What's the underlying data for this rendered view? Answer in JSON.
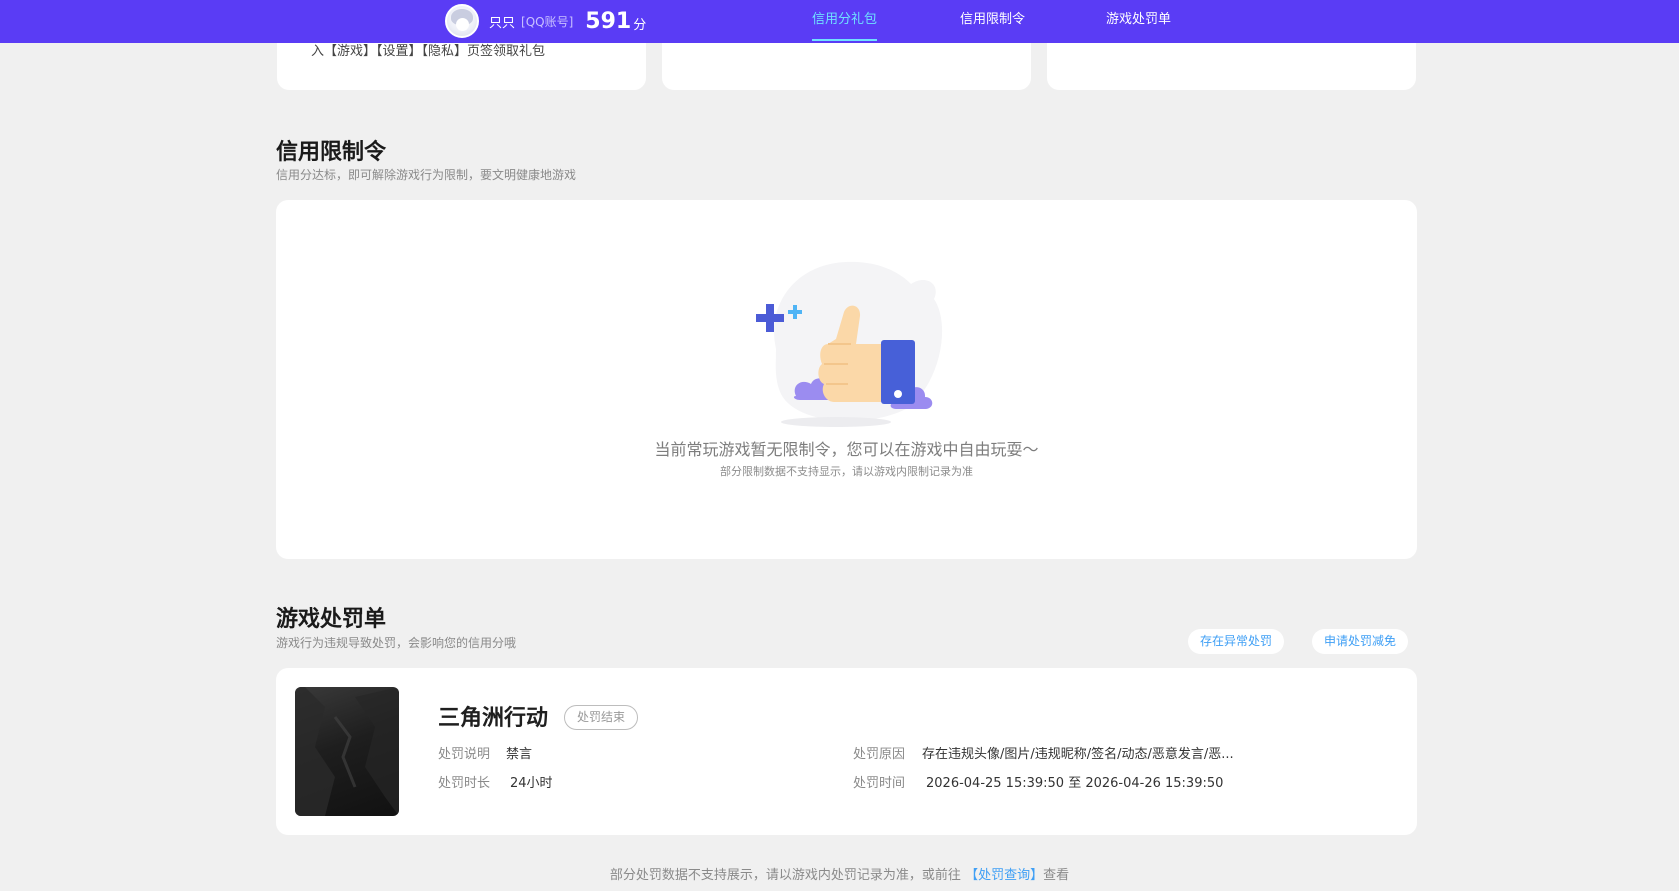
{
  "header": {
    "username": "只只",
    "account_type": "[QQ账号]",
    "score": "591",
    "score_unit": "分",
    "nav": [
      {
        "label": "信用分礼包",
        "active": true
      },
      {
        "label": "信用限制令",
        "active": false
      },
      {
        "label": "游戏处罚单",
        "active": false
      }
    ]
  },
  "gift_cards": {
    "first_card_text": "入【游戏】【设置】【隐私】页签领取礼包"
  },
  "restriction": {
    "title": "信用限制令",
    "subtitle": "信用分达标，即可解除游戏行为限制，要文明健康地游戏",
    "empty_title": "当前常玩游戏暂无限制令，您可以在游戏中自由玩耍～",
    "empty_sub": "部分限制数据不支持显示，请以游戏内限制记录为准"
  },
  "penalty": {
    "title": "游戏处罚单",
    "subtitle": "游戏行为违规导致处罚，会影响您的信用分哦",
    "action_appeal_label": "存在异常处罚",
    "action_reduce_label": "申请处罚减免",
    "record": {
      "game_name": "三角洲行动",
      "status": "处罚结束",
      "desc_label": "处罚说明",
      "desc_value": "禁言",
      "duration_label": "处罚时长",
      "duration_value": "24小时",
      "reason_label": "处罚原因",
      "reason_value": "存在违规头像/图片/违规昵称/签名/动态/恶意发言/恶...",
      "time_label": "处罚时间",
      "time_value": "2026-04-25 15:39:50 至 2026-04-26 15:39:50"
    },
    "footer_prefix": "部分处罚数据不支持展示，请以游戏内处罚记录为准，或前往",
    "footer_link": "【处罚查询】",
    "footer_suffix": "查看"
  },
  "colors": {
    "brand": "#5a3cf5",
    "accent": "#6fe0ff",
    "link": "#3f9ff5"
  }
}
